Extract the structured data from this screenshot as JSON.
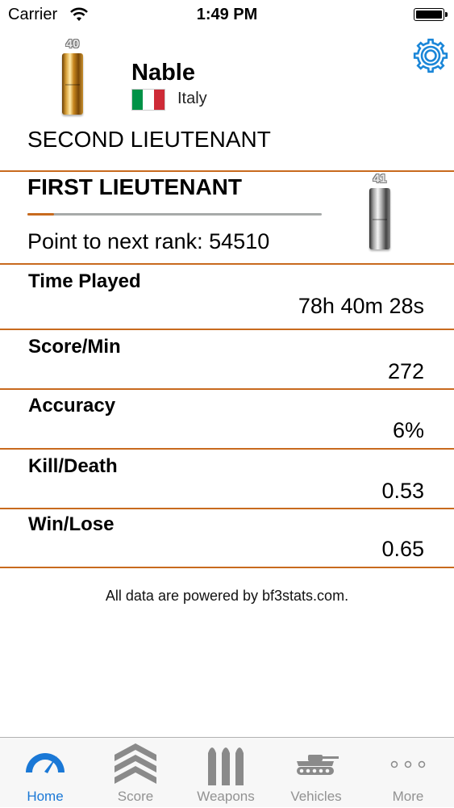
{
  "status_bar": {
    "carrier": "Carrier",
    "time": "1:49 PM"
  },
  "player": {
    "name": "Nable",
    "country": "Italy",
    "current_rank_number": "40",
    "current_rank_name": "SECOND LIEUTENANT"
  },
  "next_rank": {
    "name": "FIRST LIEUTENANT",
    "rank_number": "41",
    "progress_fraction": 0.09,
    "points_label": "Point to next rank:",
    "points_value": "54510"
  },
  "stats": [
    {
      "label": "Time Played",
      "value": "78h 40m 28s"
    },
    {
      "label": "Score/Min",
      "value": "272"
    },
    {
      "label": "Accuracy",
      "value": "6%"
    },
    {
      "label": "Kill/Death",
      "value": "0.53"
    },
    {
      "label": "Win/Lose",
      "value": "0.65"
    }
  ],
  "footer_note": "All data are powered by bf3stats.com.",
  "tabs": [
    {
      "label": "Home",
      "icon": "speedometer-icon",
      "active": true
    },
    {
      "label": "Score",
      "icon": "chevrons-icon",
      "active": false
    },
    {
      "label": "Weapons",
      "icon": "bullets-icon",
      "active": false
    },
    {
      "label": "Vehicles",
      "icon": "tank-icon",
      "active": false
    },
    {
      "label": "More",
      "icon": "more-dots-icon",
      "active": false
    }
  ],
  "colors": {
    "accent": "#c86a1e",
    "tab_active": "#1a78d6",
    "tab_inactive": "#929292",
    "flag_green": "#009246",
    "flag_white": "#ffffff",
    "flag_red": "#ce2b37"
  }
}
